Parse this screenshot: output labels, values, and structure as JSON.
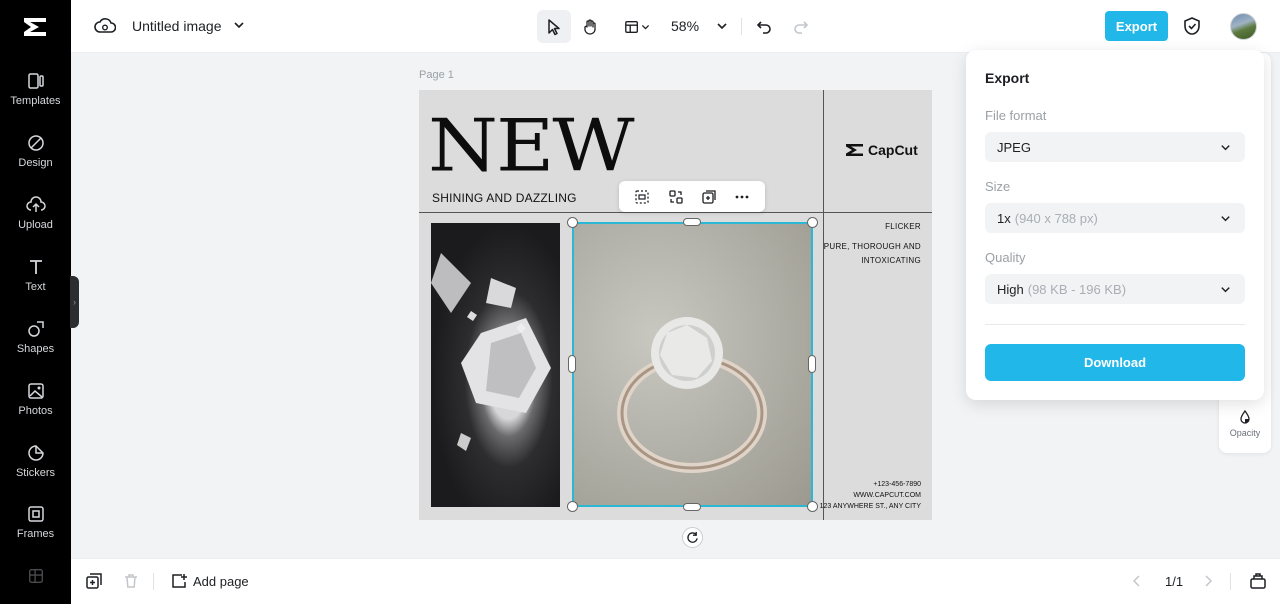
{
  "sidebar": {
    "items": [
      {
        "label": "Templates",
        "icon": "templates-icon"
      },
      {
        "label": "Design",
        "icon": "design-icon"
      },
      {
        "label": "Upload",
        "icon": "upload-icon"
      },
      {
        "label": "Text",
        "icon": "text-icon"
      },
      {
        "label": "Shapes",
        "icon": "shapes-icon"
      },
      {
        "label": "Photos",
        "icon": "photos-icon"
      },
      {
        "label": "Stickers",
        "icon": "stickers-icon"
      },
      {
        "label": "Frames",
        "icon": "frames-icon"
      }
    ]
  },
  "header": {
    "title": "Untitled image",
    "zoom": "58%",
    "export_label": "Export"
  },
  "canvas": {
    "page_label": "Page 1",
    "headline": "NEW",
    "subline": "SHINING AND DAZZLING",
    "brand": "CapCut",
    "tag1": "FLICKER",
    "tag2": "PURE, THOROUGH AND INTOXICATING",
    "phone": "+123-456-7890",
    "website": "WWW.CAPCUT.COM",
    "address": "123 ANYWHERE ST., ANY CITY"
  },
  "export_panel": {
    "title": "Export",
    "file_format_label": "File format",
    "file_format_value": "JPEG",
    "size_label": "Size",
    "size_value": "1x",
    "size_detail": "(940 x 788 px)",
    "quality_label": "Quality",
    "quality_value": "High",
    "quality_detail": "(98 KB - 196 KB)",
    "download_label": "Download"
  },
  "right_panel": {
    "opacity_label": "Opacity"
  },
  "bottom": {
    "add_page_label": "Add page",
    "pager": "1/1"
  },
  "colors": {
    "accent": "#22b7e9",
    "selection": "#2bb8d4"
  }
}
